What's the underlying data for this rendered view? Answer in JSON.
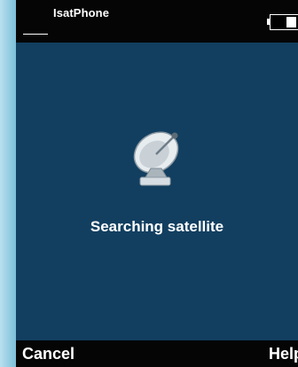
{
  "status_bar": {
    "network_name": "IsatPhone",
    "battery_level": 0.4
  },
  "main": {
    "icon": "satellite-dish-icon",
    "message": "Searching satellite"
  },
  "softkeys": {
    "left_label": "Cancel",
    "right_label": "Help"
  },
  "colors": {
    "screen_background": "#123f60",
    "bar_background": "#050505",
    "text": "#ffffff",
    "frame": "#84c4dc"
  }
}
